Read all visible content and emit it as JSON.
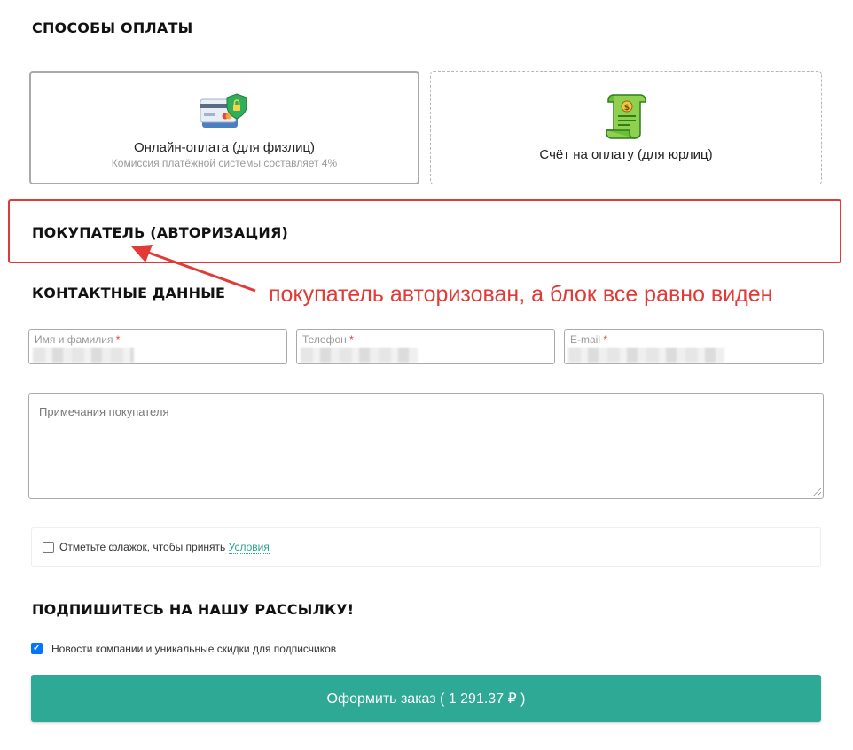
{
  "payment_methods": {
    "title": "СПОСОБЫ ОПЛАТЫ",
    "options": [
      {
        "label": "Онлайн-оплата (для физлиц)",
        "sublabel": "Комиссия платёжной системы составляет 4%",
        "icon": "credit-card-shield-icon",
        "selected": true
      },
      {
        "label": "Счёт на оплату (для юрлиц)",
        "icon": "invoice-scroll-icon",
        "selected": false
      }
    ]
  },
  "buyer": {
    "title": "ПОКУПАТЕЛЬ (АВТОРИЗАЦИЯ)"
  },
  "annotation": {
    "text": "покупатель авторизован, а блок все равно виден",
    "color": "#e23a36"
  },
  "contacts": {
    "title": "КОНТАКТНЫЕ ДАННЫЕ",
    "fields": [
      {
        "label": "Имя и фамилия",
        "required_mark": "*"
      },
      {
        "label": "Телефон",
        "required_mark": "*"
      },
      {
        "label": "E-mail",
        "required_mark": "*"
      }
    ],
    "notes_placeholder": "Примечания покупателя"
  },
  "terms": {
    "text": "Отметьте флажок, чтобы принять",
    "link": "Условия",
    "checked": false
  },
  "newsletter": {
    "title": "ПОДПИШИТЕСЬ НА НАШУ РАССЫЛКУ!",
    "checkbox_label": "Новости компании и уникальные скидки для подписчиков",
    "checked": true
  },
  "submit": {
    "label": "Оформить заказ ( 1 291.37 ₽ )",
    "color": "#2ea995"
  }
}
